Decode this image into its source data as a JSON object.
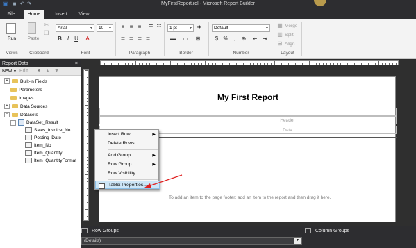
{
  "window": {
    "title": "MyFirstReport.rdl - Microsoft Report Builder"
  },
  "tabs": [
    {
      "label": "File"
    },
    {
      "label": "Home"
    },
    {
      "label": "Insert"
    },
    {
      "label": "View"
    }
  ],
  "ribbon": {
    "run_label": "Run",
    "paste_label": "Paste",
    "font_name": "Arial",
    "font_size": "10",
    "border_width": "1 pt",
    "number_format": "Default",
    "merge_label": "Merge",
    "split_label": "Split",
    "align_label": "Align",
    "groups": [
      {
        "label": "Views"
      },
      {
        "label": "Clipboard"
      },
      {
        "label": "Font"
      },
      {
        "label": "Paragraph"
      },
      {
        "label": "Border"
      },
      {
        "label": "Number"
      },
      {
        "label": "Layout"
      }
    ]
  },
  "report_data": {
    "header": "Report Data",
    "close_glyph": "×",
    "new_label": "New",
    "edit_label": "Edit...",
    "tree": [
      {
        "label": "Built-in Fields"
      },
      {
        "label": "Parameters"
      },
      {
        "label": "Images"
      },
      {
        "label": "Data Sources"
      },
      {
        "label": "Datasets"
      },
      {
        "label": "DataSet_Result"
      },
      {
        "label": "Sales_Invoice_No"
      },
      {
        "label": "Posting_Date"
      },
      {
        "label": "Item_No"
      },
      {
        "label": "Item_Quantity"
      },
      {
        "label": "Item_QuantityFormat"
      }
    ]
  },
  "report": {
    "title": "My First Report",
    "header_cell": "Header",
    "data_cell": "Data",
    "footer_hint": "To add an item to the page footer: add an item to the report and then drag it here."
  },
  "context_menu": [
    {
      "label": "Insert Row",
      "submenu": true
    },
    {
      "label": "Delete Rows",
      "submenu": false
    },
    {
      "label": "Add Group",
      "submenu": true
    },
    {
      "label": "Row Group",
      "submenu": true
    },
    {
      "label": "Row Visibility...",
      "submenu": false
    },
    {
      "label": "Tablix Properties...",
      "submenu": false
    }
  ],
  "grouping": {
    "row_groups": "Row Groups",
    "column_groups": "Column Groups",
    "details": "(Details)"
  },
  "colors": {
    "accent": "#2d2d30",
    "highlight": "#cde6f7",
    "arrow": "#e02020"
  }
}
